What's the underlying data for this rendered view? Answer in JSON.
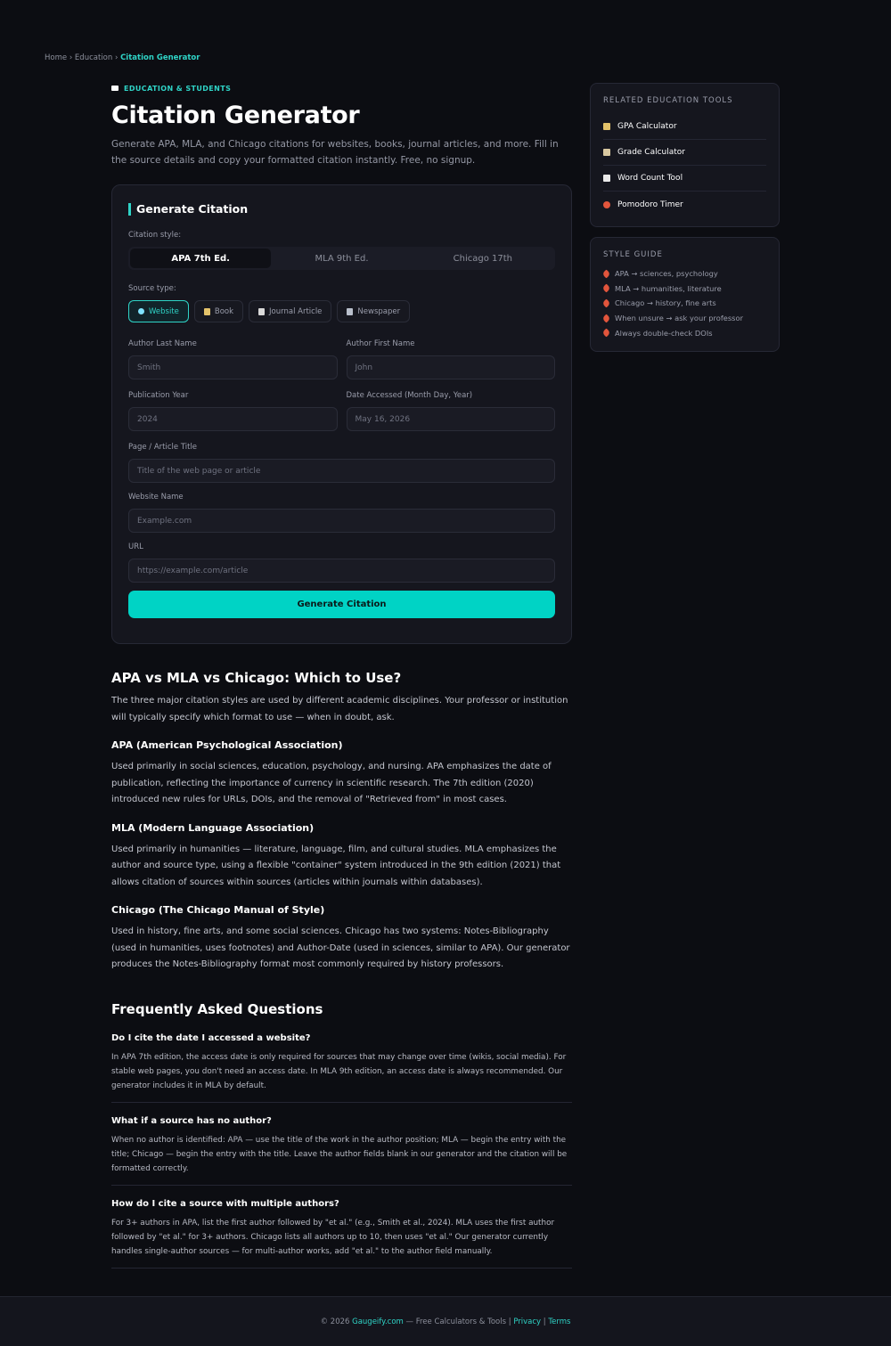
{
  "breadcrumb": {
    "home": "Home",
    "sep": "›",
    "section": "Education",
    "current": "Citation Generator"
  },
  "hero": {
    "eyebrow": "EDUCATION & STUDENTS",
    "title": "Citation Generator",
    "intro": "Generate APA, MLA, and Chicago citations for websites, books, journal articles, and more. Fill in the source details and copy your formatted citation instantly. Free, no signup."
  },
  "form": {
    "title": "Generate Citation",
    "style_label": "Citation style:",
    "styles": [
      "APA 7th Ed.",
      "MLA 9th Ed.",
      "Chicago 17th"
    ],
    "source_label": "Source type:",
    "sources": [
      "Website",
      "Book",
      "Journal Article",
      "Newspaper"
    ],
    "author_last": {
      "label": "Author Last Name",
      "placeholder": "Smith"
    },
    "author_first": {
      "label": "Author First Name",
      "placeholder": "John"
    },
    "pub_year": {
      "label": "Publication Year",
      "placeholder": "2024"
    },
    "accessed": {
      "label": "Date Accessed (Month Day, Year)",
      "placeholder": "May 16, 2026"
    },
    "page_title": {
      "label": "Page / Article Title",
      "placeholder": "Title of the web page or article"
    },
    "site_name": {
      "label": "Website Name",
      "placeholder": "Example.com"
    },
    "url": {
      "label": "URL",
      "placeholder": "https://example.com/article"
    },
    "submit": "Generate Citation"
  },
  "article": {
    "h2": "APA vs MLA vs Chicago: Which to Use?",
    "lead": "The three major citation styles are used by different academic disciplines. Your professor or institution will typically specify which format to use — when in doubt, ask.",
    "apa_h": "APA (American Psychological Association)",
    "apa_p": "Used primarily in social sciences, education, psychology, and nursing. APA emphasizes the date of publication, reflecting the importance of currency in scientific research. The 7th edition (2020) introduced new rules for URLs, DOIs, and the removal of \"Retrieved from\" in most cases.",
    "mla_h": "MLA (Modern Language Association)",
    "mla_p": "Used primarily in humanities — literature, language, film, and cultural studies. MLA emphasizes the author and source type, using a flexible \"container\" system introduced in the 9th edition (2021) that allows citation of sources within sources (articles within journals within databases).",
    "chi_h": "Chicago (The Chicago Manual of Style)",
    "chi_p": "Used in history, fine arts, and some social sciences. Chicago has two systems: Notes-Bibliography (used in humanities, uses footnotes) and Author-Date (used in sciences, similar to APA). Our generator produces the Notes-Bibliography format most commonly required by history professors."
  },
  "faq": {
    "title": "Frequently Asked Questions",
    "items": [
      {
        "q": "Do I cite the date I accessed a website?",
        "a": "In APA 7th edition, the access date is only required for sources that may change over time (wikis, social media). For stable web pages, you don't need an access date. In MLA 9th edition, an access date is always recommended. Our generator includes it in MLA by default."
      },
      {
        "q": "What if a source has no author?",
        "a": "When no author is identified: APA — use the title of the work in the author position; MLA — begin the entry with the title; Chicago — begin the entry with the title. Leave the author fields blank in our generator and the citation will be formatted correctly."
      },
      {
        "q": "How do I cite a source with multiple authors?",
        "a": "For 3+ authors in APA, list the first author followed by \"et al.\" (e.g., Smith et al., 2024). MLA uses the first author followed by \"et al.\" for 3+ authors. Chicago lists all authors up to 10, then uses \"et al.\" Our generator currently handles single-author sources — for multi-author works, add \"et al.\" to the author field manually."
      }
    ]
  },
  "sidebar": {
    "related_title": "RELATED EDUCATION TOOLS",
    "tools": [
      {
        "label": "GPA Calculator",
        "icon": "books-icon",
        "color": "#e3c26a"
      },
      {
        "label": "Grade Calculator",
        "icon": "clipboard-icon",
        "color": "#d8c7a0"
      },
      {
        "label": "Word Count Tool",
        "icon": "memo-icon",
        "color": "#e9e9e9"
      },
      {
        "label": "Pomodoro Timer",
        "icon": "tomato-icon",
        "color": "#e2553c"
      }
    ],
    "guide_title": "STYLE GUIDE",
    "guide": [
      "APA → sciences, psychology",
      "MLA → humanities, literature",
      "Chicago → history, fine arts",
      "When unsure → ask your professor",
      "Always double-check DOIs"
    ]
  },
  "footer": {
    "prefix": "© 2026",
    "brand": "Gaugeify.com",
    "tagline": "— Free Calculators & Tools",
    "sep": "|",
    "privacy": "Privacy",
    "terms": "Terms"
  },
  "colors": {
    "accent": "#2fd4c7",
    "button": "#00d3c5",
    "background": "#0c0d12",
    "card": "#15161e"
  }
}
